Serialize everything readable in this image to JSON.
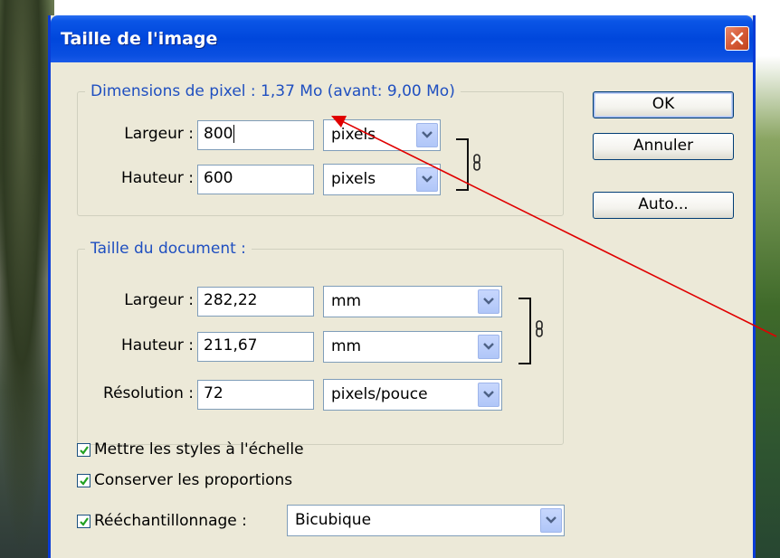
{
  "window": {
    "title": "Taille de l'image"
  },
  "pixel_dimensions": {
    "legend": "Dimensions de pixel : 1,37 Mo (avant: 9,00 Mo)",
    "width_label": "Largeur :",
    "width_value": "800",
    "width_unit": "pixels",
    "height_label": "Hauteur :",
    "height_value": "600",
    "height_unit": "pixels"
  },
  "document_size": {
    "legend": "Taille du document :",
    "width_label": "Largeur :",
    "width_value": "282,22",
    "width_unit": "mm",
    "height_label": "Hauteur :",
    "height_value": "211,67",
    "height_unit": "mm",
    "resolution_label": "Résolution :",
    "resolution_value": "72",
    "resolution_unit": "pixels/pouce"
  },
  "buttons": {
    "ok": "OK",
    "cancel": "Annuler",
    "auto": "Auto..."
  },
  "options": {
    "scale_styles": {
      "label": "Mettre les styles à l'échelle",
      "checked": true
    },
    "constrain_proportions": {
      "label": "Conserver les proportions",
      "checked": true
    },
    "resample": {
      "label": "Rééchantillonnage :",
      "checked": true,
      "method": "Bicubique"
    }
  },
  "colors": {
    "titlebar": "#0047dc",
    "dialog_bg": "#ece9d8",
    "legend_text": "#1f4fc0",
    "annotation_arrow": "#e00000"
  }
}
